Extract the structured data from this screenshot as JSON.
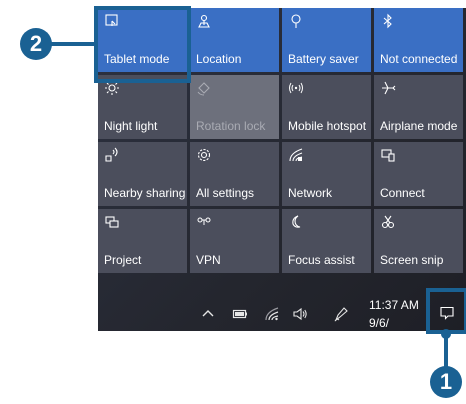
{
  "tiles": [
    {
      "label": "Tablet mode",
      "icon": "tablet-mode-icon",
      "state": "on"
    },
    {
      "label": "Location",
      "icon": "location-icon",
      "state": "on"
    },
    {
      "label": "Battery saver",
      "icon": "battery-saver-icon",
      "state": "on"
    },
    {
      "label": "Not connected",
      "icon": "bluetooth-icon",
      "state": "on"
    },
    {
      "label": "Night light",
      "icon": "night-light-icon",
      "state": "off"
    },
    {
      "label": "Rotation lock",
      "icon": "rotation-lock-icon",
      "state": "disabled"
    },
    {
      "label": "Mobile hotspot",
      "icon": "mobile-hotspot-icon",
      "state": "off"
    },
    {
      "label": "Airplane mode",
      "icon": "airplane-icon",
      "state": "off"
    },
    {
      "label": "Nearby sharing",
      "icon": "nearby-sharing-icon",
      "state": "off"
    },
    {
      "label": "All settings",
      "icon": "gear-icon",
      "state": "off"
    },
    {
      "label": "Network",
      "icon": "network-icon",
      "state": "off"
    },
    {
      "label": "Connect",
      "icon": "connect-icon",
      "state": "off"
    },
    {
      "label": "Project",
      "icon": "project-icon",
      "state": "off"
    },
    {
      "label": "VPN",
      "icon": "vpn-icon",
      "state": "off"
    },
    {
      "label": "Focus assist",
      "icon": "focus-assist-icon",
      "state": "off"
    },
    {
      "label": "Screen snip",
      "icon": "screen-snip-icon",
      "state": "off"
    }
  ],
  "taskbar": {
    "icons": [
      "chevron-up-icon",
      "battery-icon",
      "wifi-icon",
      "volume-icon",
      "pen-icon",
      "action-center-icon"
    ],
    "time": "11:37 AM",
    "date": "9/6/"
  },
  "callouts": {
    "one": "1",
    "two": "2"
  },
  "colors": {
    "tile_on": "#3a6fc4",
    "tile_off": "#4b4e5c",
    "callout": "#1a6193"
  }
}
